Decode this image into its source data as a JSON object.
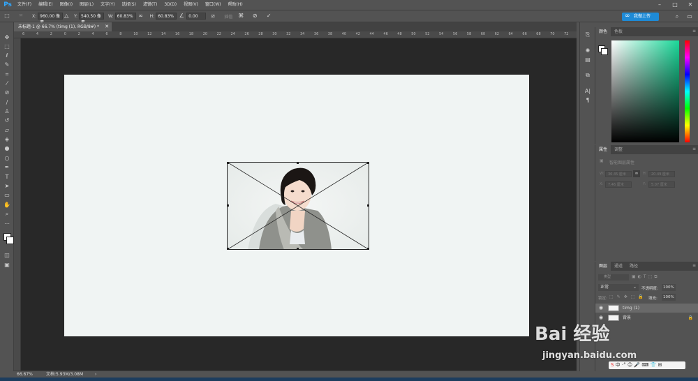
{
  "app": {
    "logo": "Ps",
    "menu": [
      "文件(F)",
      "编辑(E)",
      "图像(I)",
      "图层(L)",
      "文字(Y)",
      "选择(S)",
      "滤镜(T)",
      "3D(D)",
      "视图(V)",
      "窗口(W)",
      "帮助(H)"
    ],
    "window_controls": [
      "minimize-icon",
      "maximize-icon",
      "close-icon"
    ]
  },
  "options_bar": {
    "x_label": "X:",
    "x_value": "960.00 像素",
    "y_label": "Y:",
    "y_value": "540.50 像素",
    "w_label": "W:",
    "w_value": "60.83%",
    "h_label": "H:",
    "h_value": "60.83%",
    "angle_value": "0.00",
    "interp_label": "插值",
    "cloud_button": "我做上传"
  },
  "document": {
    "tab_title": "未标题-1 @ 66.7% (timg (1), RGB/8#) *",
    "ruler_ticks": [
      "6",
      "4",
      "2",
      "0",
      "2",
      "4",
      "6",
      "8",
      "10",
      "12",
      "14",
      "16",
      "18",
      "20",
      "22",
      "24",
      "26",
      "28",
      "30",
      "32",
      "34",
      "36",
      "38",
      "40",
      "42",
      "44",
      "46",
      "48",
      "50",
      "52",
      "54",
      "56",
      "58",
      "60",
      "62",
      "64",
      "66",
      "68",
      "70",
      "72"
    ]
  },
  "status": {
    "zoom": "66.67%",
    "doc_info": "文档:5.93M/3.08M"
  },
  "color_panel": {
    "tabs": [
      "颜色",
      "色板"
    ],
    "colors": {
      "field_hue": "#1ad899",
      "panel_bg": "#535353",
      "canvas_bg": "#f0f4f3"
    }
  },
  "properties_panel": {
    "tabs": [
      "属性",
      "调整"
    ],
    "title": "智能图层属性",
    "w_label": "W:",
    "w_value": "36.45 厘米",
    "h_label": "H:",
    "h_value": "20.49 厘米",
    "x_label": "X:",
    "x_value": "7.46 厘米",
    "y_label": "Y:",
    "y_value": "5.07 厘米"
  },
  "layers_panel": {
    "tabs": [
      "图层",
      "通道",
      "路径"
    ],
    "filter_label": "类型",
    "blend_mode": "正常",
    "opacity_label": "不透明度:",
    "opacity_value": "100%",
    "lock_label": "锁定:",
    "fill_label": "填充:",
    "fill_value": "100%",
    "layers": [
      {
        "name": "timg (1)",
        "selected": true
      },
      {
        "name": "背景",
        "selected": false
      }
    ]
  },
  "watermark": {
    "brand": "Bai  经验",
    "url": "jingyan.baidu.com"
  }
}
